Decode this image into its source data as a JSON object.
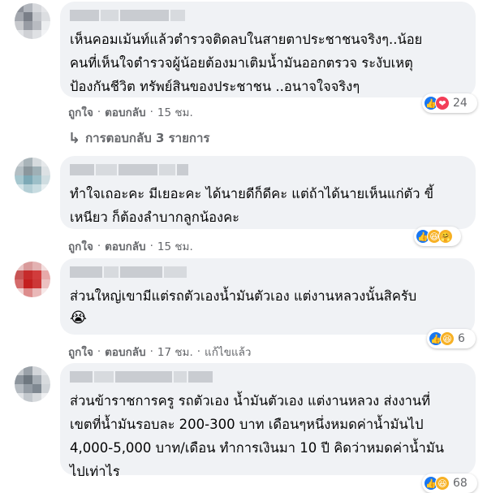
{
  "comments": [
    {
      "text": "เห็นคอมเม้นท์แล้วตำรวจติดลบในสายตาประชาชนจริงๆ..น้อย\nคนที่เห็นใจตำรวจผู้น้อยต้องมาเติมน้ำมันออกตรวจ ระงับเหตุ\nป้องกันชีวิต ทรัพย์สินของประชาชน ..อนาจใจจริงๆ",
      "like": "ถูกใจ",
      "reply": "ตอบกลับ",
      "time": "15 ชม.",
      "reaction_count": "24",
      "reactions": [
        "like-icon",
        "love-icon"
      ],
      "replies_label": "การตอบกลับ 3 รายการ"
    },
    {
      "text": "ทำใจเถอะคะ มีเยอะคะ ได้นายดีก็ดีคะ แต่ถ้าได้นายเห็นแก่ตัว ขี้\nเหนียว ก็ต้องลำบากลูกน้องคะ",
      "like": "ถูกใจ",
      "reply": "ตอบกลับ",
      "time": "15 ชม.",
      "reaction_count": "",
      "reactions": [
        "like-icon",
        "haha-icon",
        "care-icon"
      ]
    },
    {
      "text": "ส่วนใหญ่เขามีแต่รถตัวเองน้ำมันตัวเอง แต่งานหลวงนั้นสิครับ",
      "emoji": "😭",
      "like": "ถูกใจ",
      "reply": "ตอบกลับ",
      "time": "17 ชม.",
      "edited": "แก้ไขแล้ว",
      "reaction_count": "6",
      "reactions": [
        "like-icon",
        "haha-icon"
      ]
    },
    {
      "text": "ส่วนข้าราชการครู รถตัวเอง น้ำมันตัวเอง แต่งานหลวง ส่งงานที่\nเขตที่น้ำมันรอบละ 200-300 บาท เดือนๆหนึ่งหมดค่าน้ำมันไป\n4,000-5,000 บาท/เดือน ทำการเงินมา 10 ปี คิดว่าหมดค่าน้ำมัน\nไปเท่าไร",
      "reaction_count": "68",
      "reactions": [
        "like-icon",
        "haha-icon"
      ]
    }
  ],
  "colors": {
    "bubble": "#f0f2f5",
    "muted": "#65676b",
    "like": "#1877f2",
    "love": "#f33e58",
    "haha": "#f7b125"
  },
  "glyphs": {
    "like": "👍",
    "love": "❤",
    "haha": "😆",
    "care": "🤗",
    "reply_arrow": "↳",
    "dot": "·"
  }
}
